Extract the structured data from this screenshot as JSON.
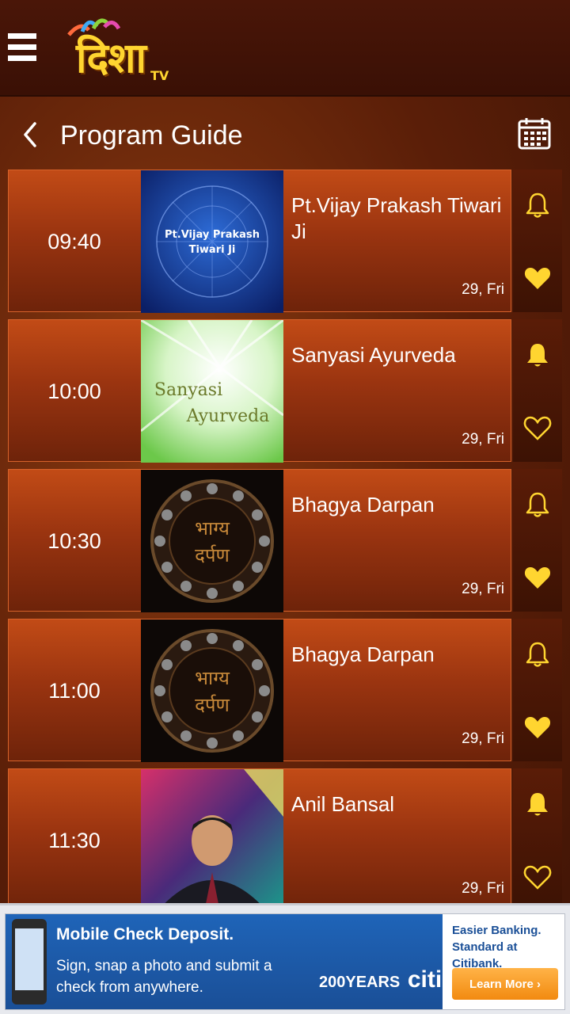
{
  "app": {
    "logo_text": "दिशा",
    "logo_sub": "TV"
  },
  "header": {
    "title": "Program Guide"
  },
  "programs": [
    {
      "time": "09:40",
      "title": "Pt.Vijay Prakash Tiwari Ji",
      "date": "29, Fri",
      "thumb_text": "Pt.Vijay Prakash Tiwari Ji",
      "reminder": false,
      "favorite": true
    },
    {
      "time": "10:00",
      "title": "Sanyasi Ayurveda",
      "date": "29, Fri",
      "thumb_text": "Sanyasi Ayurveda",
      "reminder": true,
      "favorite": false
    },
    {
      "time": "10:30",
      "title": "Bhagya Darpan",
      "date": "29, Fri",
      "thumb_text": "भाग्य दर्पण",
      "reminder": false,
      "favorite": true
    },
    {
      "time": "11:00",
      "title": "Bhagya Darpan",
      "date": "29, Fri",
      "thumb_text": "भाग्य दर्पण",
      "reminder": false,
      "favorite": true
    },
    {
      "time": "11:30",
      "title": "Anil Bansal",
      "date": "29, Fri",
      "thumb_text": "",
      "reminder": true,
      "favorite": false
    }
  ],
  "ad": {
    "headline": "Mobile Check Deposit.",
    "body": "Sign, snap a photo and submit a check from anywhere.",
    "years": "200YEARS",
    "brand": "citi",
    "tagline": "Easier Banking. Standard at Citibank.",
    "cta": "Learn More ›"
  },
  "colors": {
    "accent": "#ffd530",
    "row_bg": "#9a3410",
    "header_bg": "#3a1005"
  }
}
